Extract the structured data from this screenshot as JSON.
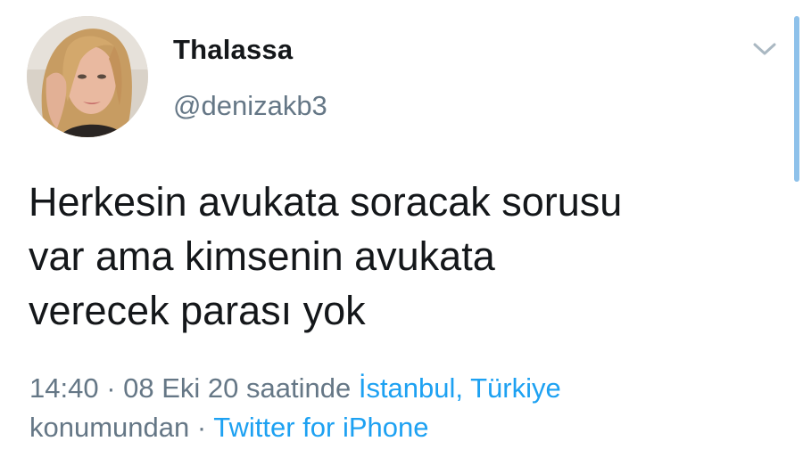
{
  "tweet": {
    "author": {
      "display_name": "Thalassa",
      "handle": "@denizakb3"
    },
    "text_lines": [
      "Herkesin avukata soracak sorusu",
      "var ama kimsenin avukata",
      "verecek parası yok"
    ],
    "meta": {
      "time": "14:40",
      "separator": " · ",
      "date_suffix": "08 Eki 20 saatinde ",
      "location": "İstanbul, Türkiye",
      "location_suffix": " konumundan",
      "source": "Twitter for iPhone"
    }
  },
  "icons": {
    "menu": "chevron-down-icon"
  },
  "colors": {
    "text": "#14171a",
    "secondary": "#657786",
    "link": "#1da1f2",
    "scrollbar": "#8ec1ea"
  }
}
